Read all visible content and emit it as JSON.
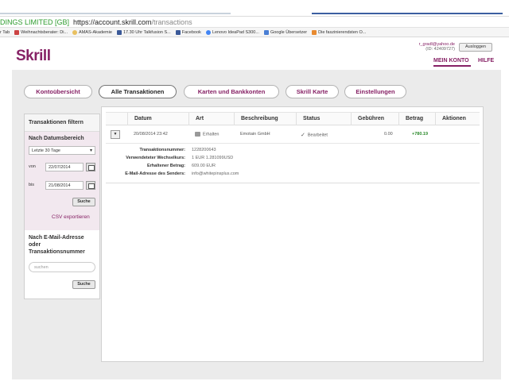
{
  "browser": {
    "cert_label": "DINGS LIMITED [GB]",
    "url_host": "https://account.skrill.com",
    "url_path": "/transactions",
    "bookmarks": [
      {
        "label": "r Tab",
        "icon": "tab-icon"
      },
      {
        "label": "Weihnachtsberater: Di...",
        "icon": "bookmark-icon"
      },
      {
        "label": "AMAS-Akademie",
        "icon": "bookmark-icon"
      },
      {
        "label": "17.30 Uhr Talkfusion S...",
        "icon": "facebook-icon"
      },
      {
        "label": "Facebook",
        "icon": "facebook-icon"
      },
      {
        "label": "Lenovo IdeaPad S300...",
        "icon": "google-icon"
      },
      {
        "label": "Google Übersetzer",
        "icon": "translate-icon"
      },
      {
        "label": "Die faszinierendsten O...",
        "icon": "bookmark-icon"
      }
    ]
  },
  "header": {
    "logo": "Skrill",
    "user_email": "r_gradl@yahoo.de",
    "user_id": "(ID: 42409727)",
    "logout_label": "Ausloggen",
    "nav_account": "MEIN KONTO",
    "nav_help": "HILFE",
    "brand_color": "#862165"
  },
  "tabs": [
    {
      "label": "Kontoübersicht",
      "active": false
    },
    {
      "label": "Alle Transaktionen",
      "active": true
    },
    {
      "label": "Karten und Bankkonten",
      "active": false
    },
    {
      "label": "Skrill Karte",
      "active": false
    },
    {
      "label": "Einstellungen",
      "active": false
    }
  ],
  "sidebar": {
    "title": "Transaktionen filtern",
    "date_section_label": "Nach Datumsbereich",
    "range_select_value": "Letzte 30 Tage",
    "from_label": "von",
    "from_value": "22/07/2014",
    "to_label": "bis",
    "to_value": "21/08/2014",
    "search_label": "Suche",
    "csv_label": "CSV exportieren",
    "email_section_label": "Nach E-Mail-Adresse oder Transaktionsnummer",
    "email_placeholder": "suchen",
    "search2_label": "Suche"
  },
  "table": {
    "columns": [
      "Datum",
      "Art",
      "Beschreibung",
      "Status",
      "Gebühren",
      "Betrag",
      "Aktionen"
    ],
    "rows": [
      {
        "date": "20/08/2014 23:42",
        "type": "Erhalten",
        "description": "Emotain GmbH",
        "status": "Bearbeitet",
        "fees": "0.00",
        "amount": "+780.19",
        "actions": ""
      }
    ],
    "details": [
      {
        "label": "Transaktionsnummer:",
        "value": "1228200643"
      },
      {
        "label": "Verwendeteter Wechselkurs:",
        "value": "1 EUR 1.281099USD"
      },
      {
        "label": "Erhaltener Betrag:",
        "value": "609.00 EUR"
      },
      {
        "label": "E-Mail-Adresse des Senders:",
        "value": "info@whitepinsplus.com"
      }
    ]
  }
}
